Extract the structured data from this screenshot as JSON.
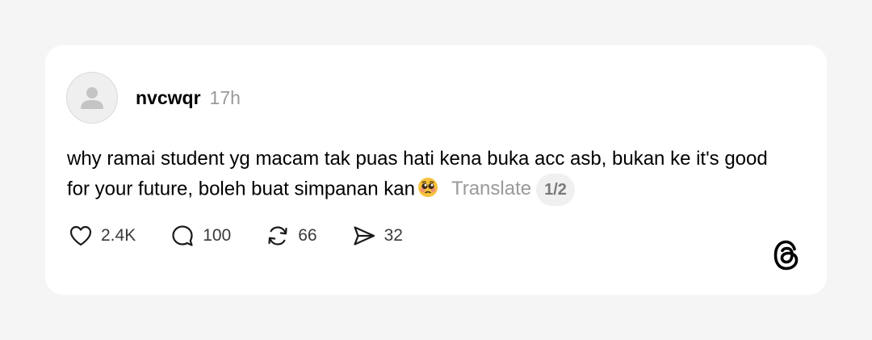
{
  "post": {
    "username": "nvcwqr",
    "timestamp": "17h",
    "text": "why ramai student yg macam tak puas hati kena buka acc asb, bukan ke it's good for your future, boleh buat simpanan kan",
    "emoji": "pleading-face",
    "translate_label": "Translate",
    "page_indicator": "1/2"
  },
  "actions": {
    "likes": "2.4K",
    "comments": "100",
    "reposts": "66",
    "shares": "32"
  },
  "brand": {
    "logo": "threads-logo"
  }
}
